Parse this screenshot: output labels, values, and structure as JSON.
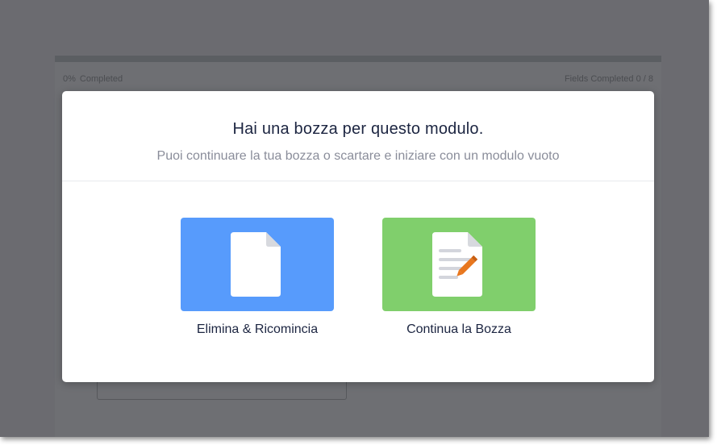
{
  "background_form": {
    "progress_percent_label": "0%",
    "progress_completed_label": "Completed",
    "progress_fraction": 0,
    "fields_completed_label": "Fields Completed",
    "fields_completed_count": "0 / 8"
  },
  "modal": {
    "title": "Hai una bozza per questo modulo.",
    "subtitle": "Puoi continuare la tua bozza o scartare e iniziare con un modulo vuoto",
    "options": [
      {
        "label": "Elimina & Ricomincia",
        "icon": "blank-document-icon",
        "color": "#579bfc"
      },
      {
        "label": "Continua la Bozza",
        "icon": "edit-document-icon",
        "color": "#80cf6c"
      }
    ]
  },
  "colors": {
    "overlay": "#6b6b70",
    "title_text": "#1c2541",
    "subtitle_text": "#8a8d9a",
    "pencil": "#e8771e"
  }
}
